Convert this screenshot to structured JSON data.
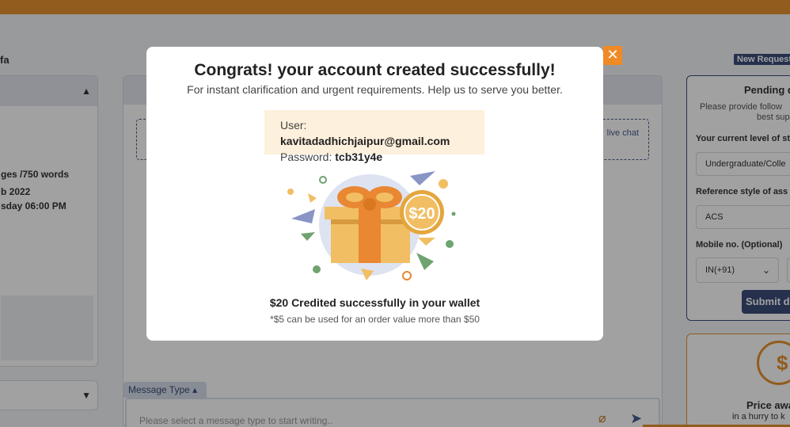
{
  "background": {
    "user_name_fragment": "fa",
    "left_card": {
      "lines": [
        "ges /750 words",
        "b 2022",
        "sday 06:00 PM"
      ]
    },
    "chat_box_text": "live chat",
    "message_type_label": "Message Type",
    "message_placeholder": "Please select a message type to start writing..",
    "new_request_tag": "New Request",
    "pending_card": {
      "title": "Pending d",
      "desc_line1": "Please provide follow",
      "desc_line2": "best sup",
      "level_label": "Your current level of st",
      "level_value": "Undergraduate/Colle",
      "reference_label": "Reference style of ass",
      "reference_value": "ACS",
      "mobile_label": "Mobile no. (Optional)",
      "country_code": "IN(+91)",
      "submit_label": "Submit d"
    },
    "price_card": {
      "title": "Price awa",
      "subtitle": "in a hurry to k",
      "coin_symbol": "$"
    }
  },
  "modal": {
    "close_label": "✕",
    "title": "Congrats! your account created successfully!",
    "subtitle": "For instant clarification and urgent requirements. Help us to serve you better.",
    "user_label": "User:",
    "user_value": "kavitadadhichjaipur@gmail.com",
    "password_label": "Password:",
    "password_value": "tcb31y4e",
    "gift_amount": "$20",
    "credited_text": "$20 Credited successfully in your wallet",
    "note": "*$5 can be used for an order value more than $50"
  },
  "colors": {
    "accent_orange": "#e6922e",
    "navy": "#3b4c7a",
    "gift_box": "#f2be63",
    "gift_ribbon": "#e98732"
  }
}
